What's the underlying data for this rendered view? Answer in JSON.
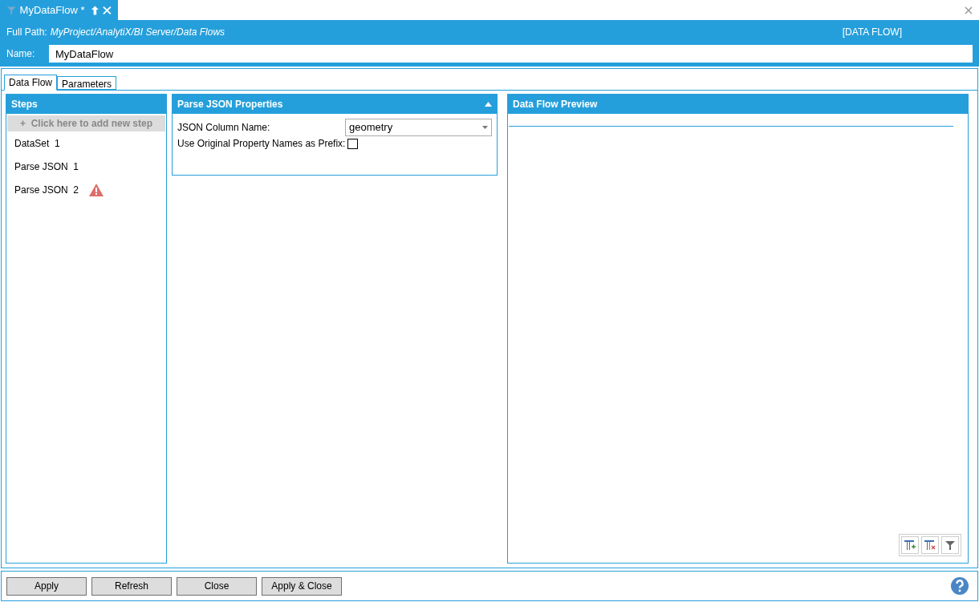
{
  "document_tab": {
    "title": "MyDataFlow *"
  },
  "header": {
    "path_label": "Full Path:",
    "path": "MyProject/AnalytiX/BI Server/Data Flows",
    "type": "[DATA FLOW]",
    "name_label": "Name:",
    "name_value": "MyDataFlow"
  },
  "tabs": [
    {
      "label": "Data Flow",
      "selected": true
    },
    {
      "label": "Parameters",
      "selected": false
    }
  ],
  "steps": {
    "title": "Steps",
    "add_label": "+  Click here to add new step",
    "items": [
      {
        "label": "DataSet  1",
        "warning": false
      },
      {
        "label": "Parse JSON  1",
        "warning": false
      },
      {
        "label": "Parse JSON  2",
        "warning": true
      }
    ]
  },
  "properties": {
    "title": "Parse JSON Properties",
    "column_label": "JSON Column Name:",
    "column_value": "geometry",
    "prefix_label": "Use Original Property Names as Prefix:",
    "prefix_checked": false
  },
  "preview": {
    "title": "Data Flow Preview"
  },
  "buttons": [
    "Apply",
    "Refresh",
    "Close",
    "Apply & Close"
  ]
}
